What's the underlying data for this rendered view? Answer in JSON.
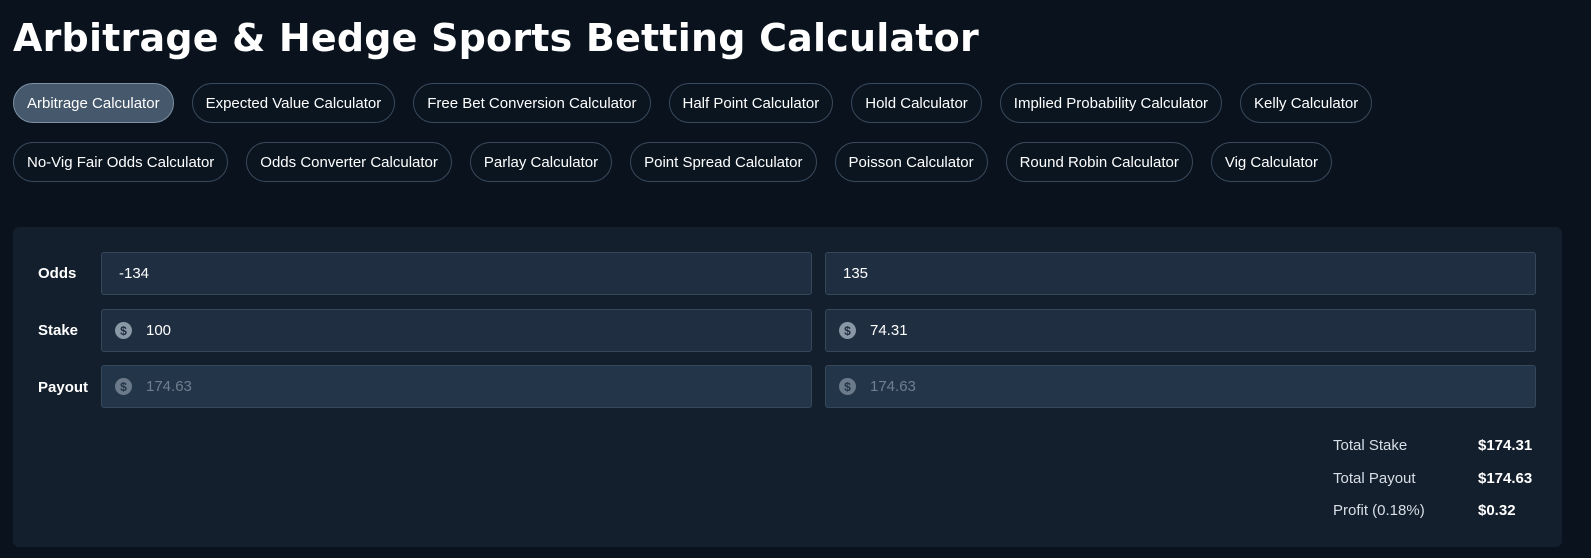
{
  "page": {
    "title": "Arbitrage & Hedge Sports Betting Calculator"
  },
  "tabs_row1": [
    {
      "label": "Arbitrage Calculator",
      "active": true
    },
    {
      "label": "Expected Value Calculator"
    },
    {
      "label": "Free Bet Conversion Calculator"
    },
    {
      "label": "Half Point Calculator"
    },
    {
      "label": "Hold Calculator"
    },
    {
      "label": "Implied Probability Calculator"
    },
    {
      "label": "Kelly Calculator"
    }
  ],
  "tabs_row2": [
    {
      "label": "No-Vig Fair Odds Calculator"
    },
    {
      "label": "Odds Converter Calculator"
    },
    {
      "label": "Parlay Calculator"
    },
    {
      "label": "Point Spread Calculator"
    },
    {
      "label": "Poisson Calculator"
    },
    {
      "label": "Round Robin Calculator"
    },
    {
      "label": "Vig Calculator"
    }
  ],
  "calculator": {
    "odds": {
      "label": "Odds",
      "bet1": "-134",
      "bet2": "135"
    },
    "stake": {
      "label": "Stake",
      "bet1": "100",
      "bet2": "74.31"
    },
    "payout": {
      "label": "Payout",
      "bet1": "174.63",
      "bet2": "174.63"
    }
  },
  "summary": {
    "total_stake_label": "Total Stake",
    "total_stake_value": "$174.31",
    "total_payout_label": "Total Payout",
    "total_payout_value": "$174.63",
    "profit_label": "Profit (0.18%)",
    "profit_value": "$0.32"
  },
  "icons": {
    "currency": "dollar-circle-icon",
    "currency_glyph": "$"
  },
  "colors": {
    "background": "#09121d",
    "card": "#131f2c",
    "field": "#1f2e40",
    "active_tab": "#45586c"
  }
}
